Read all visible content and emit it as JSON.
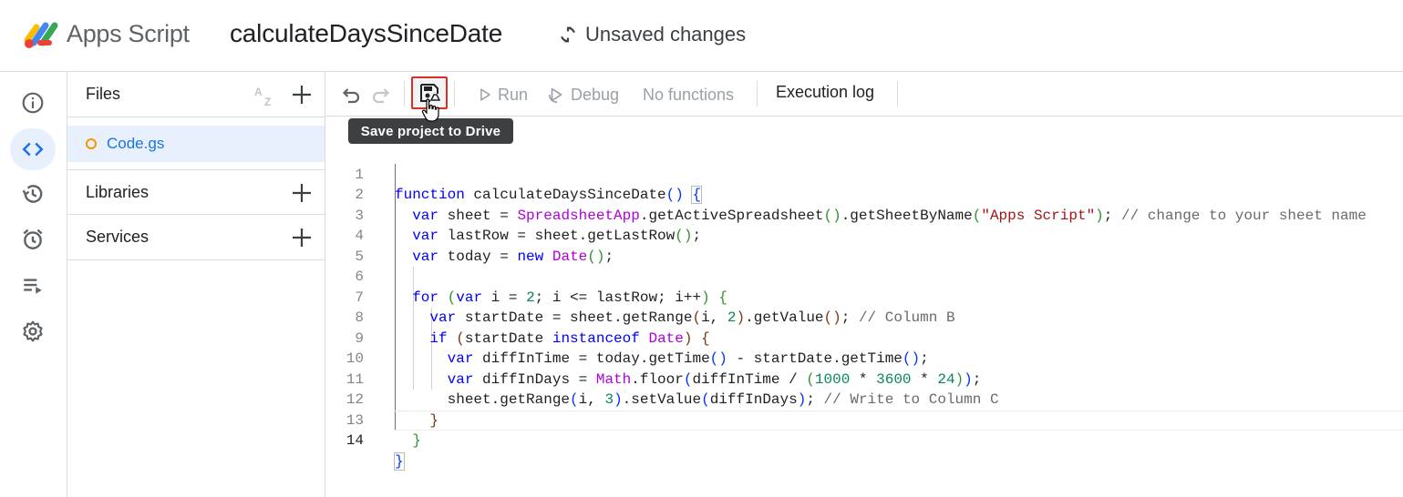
{
  "header": {
    "app_name": "Apps Script",
    "project_title": "calculateDaysSinceDate",
    "status": "Unsaved changes"
  },
  "rail": {
    "items": [
      {
        "icon": "info-icon",
        "label": "Overview"
      },
      {
        "icon": "code-icon",
        "label": "Editor",
        "active": true
      },
      {
        "icon": "history-icon",
        "label": "Project history"
      },
      {
        "icon": "alarm-icon",
        "label": "Triggers"
      },
      {
        "icon": "executions-icon",
        "label": "Executions"
      },
      {
        "icon": "gear-icon",
        "label": "Project settings"
      }
    ]
  },
  "files_panel": {
    "files_label": "Files",
    "sort_icon": "az-sort-icon",
    "files": [
      {
        "name": "Code.gs",
        "status_color": "#f29900"
      }
    ],
    "libraries_label": "Libraries",
    "services_label": "Services"
  },
  "toolbar": {
    "run_label": "Run",
    "debug_label": "Debug",
    "function_select": "No functions",
    "execution_log_label": "Execution log",
    "save_tooltip": "Save project to Drive"
  },
  "editor": {
    "line_numbers": [
      "1",
      "2",
      "3",
      "4",
      "5",
      "6",
      "7",
      "8",
      "9",
      "10",
      "11",
      "12",
      "13",
      "14"
    ],
    "current_line": "14",
    "lines": [
      "function calculateDaysSinceDate() {",
      "  var sheet = SpreadsheetApp.getActiveSpreadsheet().getSheetByName(\"Apps Script\"); // change to your sheet name",
      "  var lastRow = sheet.getLastRow();",
      "  var today = new Date();",
      "",
      "  for (var i = 2; i <= lastRow; i++) {",
      "    var startDate = sheet.getRange(i, 2).getValue(); // Column B",
      "    if (startDate instanceof Date) {",
      "      var diffInTime = today.getTime() - startDate.getTime();",
      "      var diffInDays = Math.floor(diffInTime / (1000 * 3600 * 24));",
      "      sheet.getRange(i, 3).setValue(diffInDays); // Write to Column C",
      "    }",
      "  }",
      "}"
    ]
  },
  "colors": {
    "accent": "#1a73e8",
    "active_bg": "#e8f0fe",
    "highlight_border": "#d93025",
    "keyword": "#0000ff",
    "class": "#af00db",
    "string": "#a31515",
    "number": "#098658",
    "comment": "#6a6a6a"
  }
}
